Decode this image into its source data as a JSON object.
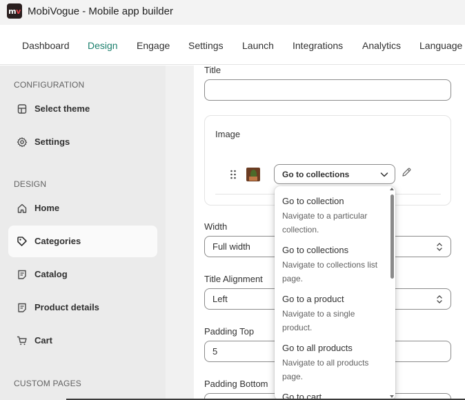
{
  "app": {
    "title": "MobiVogue - Mobile app builder",
    "logo_text": "m",
    "logo_accent": "v"
  },
  "nav": {
    "items": [
      "Dashboard",
      "Design",
      "Engage",
      "Settings",
      "Launch",
      "Integrations",
      "Analytics",
      "Language"
    ],
    "active": "Design"
  },
  "sidebar": {
    "config_heading": "CONFIGURATION",
    "config_items": [
      {
        "label": "Select theme",
        "icon": "theme-icon"
      },
      {
        "label": "Settings",
        "icon": "gear-icon"
      }
    ],
    "design_heading": "DESIGN",
    "design_items": [
      {
        "label": "Home",
        "icon": "home-icon"
      },
      {
        "label": "Categories",
        "icon": "tag-icon"
      },
      {
        "label": "Catalog",
        "icon": "catalog-icon"
      },
      {
        "label": "Product details",
        "icon": "product-details-icon"
      },
      {
        "label": "Cart",
        "icon": "cart-icon"
      }
    ],
    "active": "Categories",
    "custom_heading": "CUSTOM PAGES"
  },
  "form": {
    "title_label": "Title",
    "title_value": "",
    "image_card": {
      "heading": "Image",
      "link_value": "Go to collections"
    },
    "width_label": "Width",
    "width_value": "Full width",
    "alignment_label": "Title Alignment",
    "alignment_value": "Left",
    "padding_top_label": "Padding Top",
    "padding_top_value": "5",
    "padding_bottom_label": "Padding Bottom"
  },
  "dropdown": {
    "options": [
      {
        "title": "Go to collection",
        "desc_lines": [
          "Navigate to a particular",
          "collection."
        ]
      },
      {
        "title": "Go to collections",
        "desc_lines": [
          "Navigate to collections list",
          "page."
        ]
      },
      {
        "title": "Go to a product",
        "desc_lines": [
          "Navigate to a single",
          "product."
        ]
      },
      {
        "title": "Go to all products",
        "desc_lines": [
          "Navigate to all products",
          "page."
        ]
      },
      {
        "title": "Go to cart",
        "desc_lines": []
      }
    ]
  },
  "colors": {
    "accent": "#1a7f6c",
    "sidebar_bg": "#ebebeb",
    "logo_bg": "#2a1f1f",
    "logo_accent": "#e8424b"
  }
}
